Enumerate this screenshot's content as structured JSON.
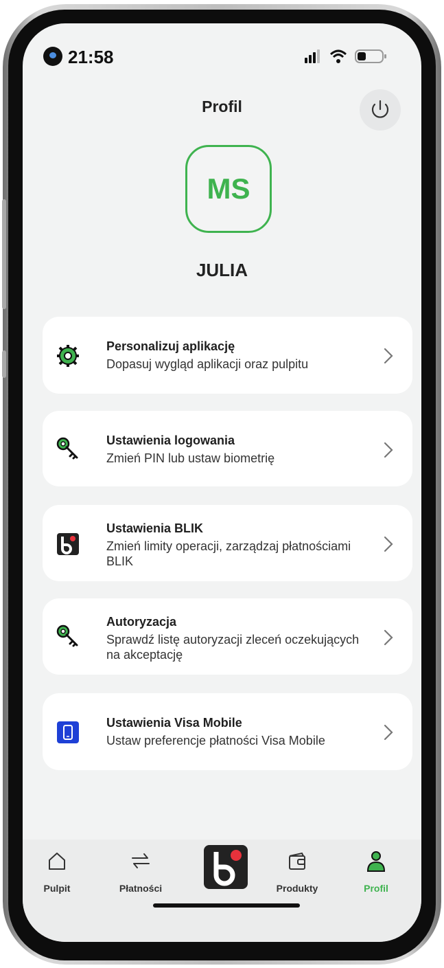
{
  "status_bar": {
    "time": "21:58"
  },
  "header": {
    "title": "Profil"
  },
  "profile": {
    "initials": "MS",
    "name": "JULIA"
  },
  "menu": [
    {
      "title": "Personalizuj aplikację",
      "description": "Dopasuj wygląd aplikacji oraz pulpitu",
      "icon": "gear-icon"
    },
    {
      "title": "Ustawienia logowania",
      "description": "Zmień PIN lub ustaw biometrię",
      "icon": "key-icon"
    },
    {
      "title": "Ustawienia BLIK",
      "description": "Zmień limity operacji, zarządzaj płatnościami BLIK",
      "icon": "blik-icon"
    },
    {
      "title": "Autoryzacja",
      "description": "Sprawdź listę autoryzacji zleceń oczekujących na akceptację",
      "icon": "key-icon"
    },
    {
      "title": "Ustawienia Visa Mobile",
      "description": "Ustaw preferencje płatności Visa Mobile",
      "icon": "phone-icon"
    }
  ],
  "tabs": [
    {
      "label": "Pulpit",
      "icon": "home-icon"
    },
    {
      "label": "Płatności",
      "icon": "transfer-icon"
    },
    {
      "label": "",
      "icon": "blik-icon"
    },
    {
      "label": "Produkty",
      "icon": "wallet-icon"
    },
    {
      "label": "Profil",
      "icon": "user-icon",
      "active": true
    }
  ],
  "colors": {
    "accent": "#3fb34f",
    "blik_red": "#e8323c",
    "visa_blue": "#1e40d6"
  }
}
